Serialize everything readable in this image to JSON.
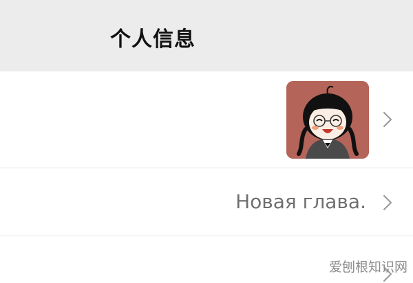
{
  "header": {
    "title": "个人信息"
  },
  "rows": {
    "avatar": {
      "icon": "chevron-right-icon"
    },
    "name": {
      "value": "Новая глава.",
      "icon": "chevron-right-icon"
    },
    "next": {
      "icon": "chevron-right-icon"
    }
  },
  "watermark": {
    "text": "爱刨根知识网"
  },
  "colors": {
    "nav_background": "#ececec",
    "divider": "#e6e6e6",
    "chevron": "#9b9b9b",
    "secondary_text": "#6f6f6f",
    "avatar_background": "#b46458"
  }
}
